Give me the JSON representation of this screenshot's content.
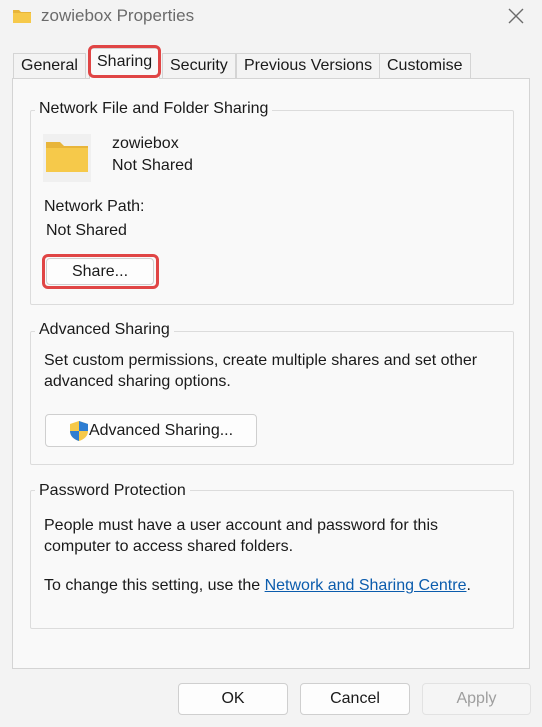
{
  "window": {
    "title": "zowiebox Properties",
    "title_icon": "folder-icon",
    "close_icon": "close-icon"
  },
  "tabs": [
    {
      "label": "General",
      "active": false
    },
    {
      "label": "Sharing",
      "active": true
    },
    {
      "label": "Security",
      "active": false
    },
    {
      "label": "Previous Versions",
      "active": false
    },
    {
      "label": "Customise",
      "active": false
    }
  ],
  "network_sharing": {
    "heading": "Network File and Folder Sharing",
    "folder_name": "zowiebox",
    "folder_status": "Not Shared",
    "network_path_label": "Network Path:",
    "network_path_value": "Not Shared",
    "share_button": "Share..."
  },
  "advanced_sharing": {
    "heading": "Advanced Sharing",
    "description_line1": "Set custom permissions, create multiple shares and set other",
    "description_line2": "advanced sharing options.",
    "button": "Advanced Sharing...",
    "button_icon": "shield-icon"
  },
  "password_protection": {
    "heading": "Password Protection",
    "description_line1": "People must have a user account and password for this",
    "description_line2": "computer to access shared folders.",
    "change_prefix": "To change this setting, use the ",
    "link_text": "Network and Sharing Centre",
    "change_suffix": "."
  },
  "footer": {
    "ok": "OK",
    "cancel": "Cancel",
    "apply": "Apply"
  },
  "colors": {
    "highlight": "#e04545",
    "link": "#0b5cad",
    "folder": "#f6c94a"
  }
}
